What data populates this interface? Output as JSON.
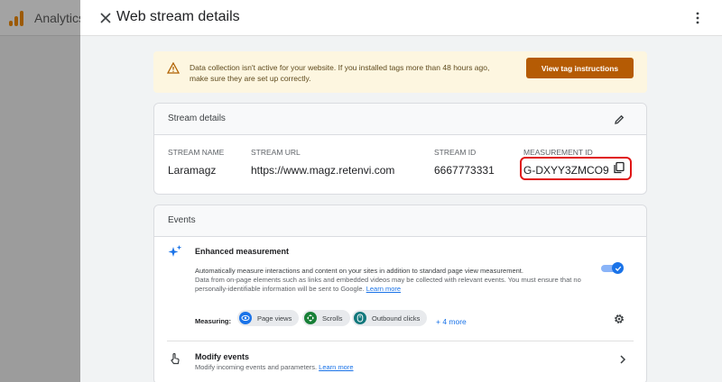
{
  "background_app": {
    "title": "Analytics",
    "brand_color": "#9c5a05"
  },
  "panel": {
    "title": "Web stream details",
    "close_icon": "close-icon",
    "more_icon": "more-vert-icon"
  },
  "alert": {
    "icon": "warning-icon",
    "text": "Data collection isn't active for your website. If you installed tags more than 48 hours ago, make sure they are set up correctly.",
    "button_label": "View tag instructions",
    "button_color": "#b55b04"
  },
  "stream_details": {
    "heading": "Stream details",
    "edit_icon": "edit-icon",
    "stream_name_label": "STREAM NAME",
    "stream_name": "Laramagz",
    "stream_url_label": "STREAM URL",
    "stream_url": "https://www.magz.retenvi.com",
    "stream_id_label": "STREAM ID",
    "stream_id": "6667773331",
    "measurement_id_label": "MEASUREMENT ID",
    "measurement_id": "G-DXYY3ZMCO9",
    "copy_icon": "copy-icon",
    "highlight_color": "#e01515"
  },
  "events": {
    "heading": "Events",
    "enhanced": {
      "title": "Enhanced measurement",
      "desc1": "Automatically measure interactions and content on your sites in addition to standard page view measurement.",
      "desc2": "Data from on-page elements such as links and embedded videos may be collected with relevant events. You must ensure that no personally-identifiable information will be sent to Google.",
      "learn_more": "Learn more",
      "toggle_on": true,
      "measuring_label": "Measuring:",
      "chips": [
        {
          "label": "Page views",
          "icon": "eye-icon",
          "color": "#1a73e8"
        },
        {
          "label": "Scrolls",
          "icon": "scroll-icon",
          "color": "#188038"
        },
        {
          "label": "Outbound clicks",
          "icon": "outbound-click-icon",
          "color": "#12787c"
        }
      ],
      "more_label": "+ 4 more"
    },
    "modify": {
      "title": "Modify events",
      "desc": "Modify incoming events and parameters.",
      "learn_more": "Learn more"
    }
  }
}
